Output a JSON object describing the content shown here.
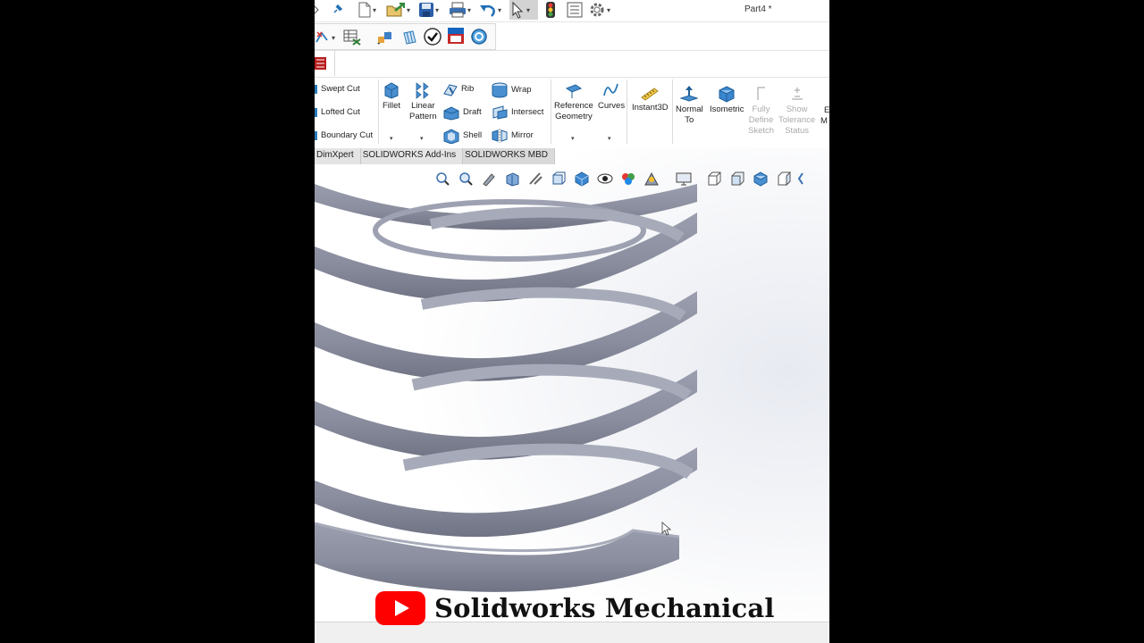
{
  "window": {
    "doc_title": "Part4 *"
  },
  "colors": {
    "accent": "#1f6fb5",
    "spring": "#8c90a0",
    "youtube_red": "#ff0000"
  },
  "ribbon": {
    "cut_group": {
      "swept_cut": "Swept Cut",
      "lofted_cut": "Lofted Cut",
      "boundary_cut": "Boundary Cut"
    },
    "fillet": "Fillet",
    "linear_pattern": [
      "Linear",
      "Pattern"
    ],
    "rib": "Rib",
    "draft": "Draft",
    "shell": "Shell",
    "wrap": "Wrap",
    "intersect": "Intersect",
    "mirror": "Mirror",
    "reference_geometry": [
      "Reference",
      "Geometry"
    ],
    "curves": "Curves",
    "instant3d": "Instant3D",
    "normal_to": [
      "Normal",
      "To"
    ],
    "isometric": "Isometric",
    "fully_define": [
      "Fully",
      "Define",
      "Sketch"
    ],
    "show_tolerance": [
      "Show",
      "Tolerance",
      "Status"
    ],
    "partial_cut": [
      "E",
      "M"
    ]
  },
  "tabs": [
    {
      "label": "DimXpert"
    },
    {
      "label": "SOLIDWORKS Add-Ins"
    },
    {
      "label": "SOLIDWORKS MBD"
    }
  ],
  "icons": {
    "toolbar": [
      "pin-icon",
      "new-document-icon",
      "open-icon",
      "save-icon",
      "print-icon",
      "undo-icon",
      "select-icon",
      "rebuild-icon",
      "file-properties-icon",
      "options-gear-icon"
    ],
    "headsup": [
      "zoom-to-fit-icon",
      "zoom-to-area-icon",
      "previous-view-icon",
      "section-view-icon",
      "dynamic-annotation-icon",
      "view-orientation-icon",
      "display-style-icon",
      "hide-show-icon",
      "edit-appearance-icon",
      "apply-scene-icon",
      "view-settings-icon"
    ]
  },
  "watermark": {
    "text": "Solidworks Mechanical"
  }
}
